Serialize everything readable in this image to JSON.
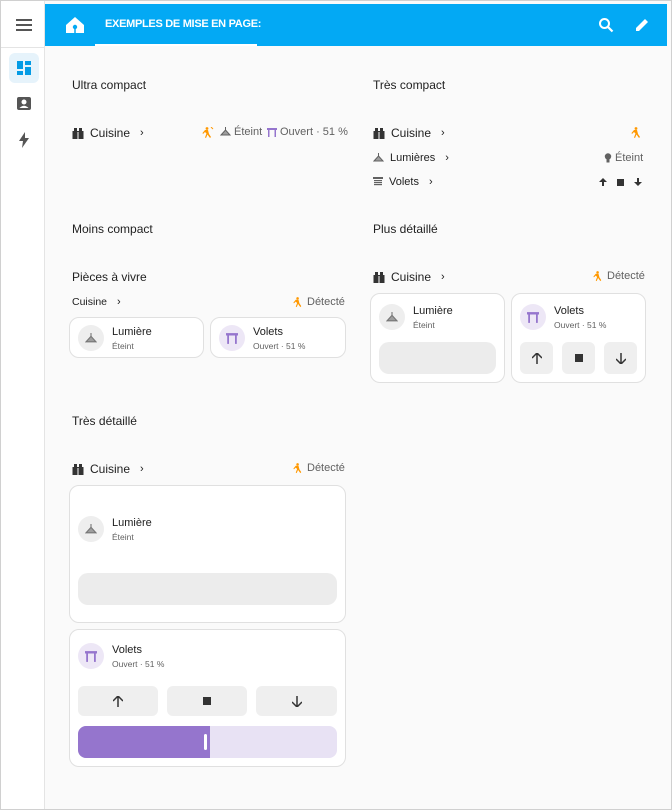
{
  "header": {
    "title": "EXEMPLES DE MISE EN PAGE:",
    "menu_icon": "menu-icon",
    "logo_icon": "home-assistant-logo-icon",
    "search_icon": "search-icon",
    "edit_icon": "pencil-icon"
  },
  "sidebar": {
    "items": [
      {
        "icon": "dashboard-icon",
        "active": true
      },
      {
        "icon": "account-box-icon",
        "active": false
      },
      {
        "icon": "lightning-icon",
        "active": false
      }
    ]
  },
  "colors": {
    "accent": "#03a9f4",
    "motion": "#ff9800",
    "cover": "#9575cd",
    "cover_light": "#e8e2f4"
  },
  "sections": {
    "ultra": {
      "title": "Ultra compact",
      "area": "Cuisine",
      "light_state": "Éteint",
      "cover_state": "Ouvert · 51 %"
    },
    "tres_compact": {
      "title": "Très compact",
      "area": "Cuisine",
      "lights_label": "Lumières",
      "light_state": "Éteint",
      "covers_label": "Volets"
    },
    "moins": {
      "title": "Moins compact",
      "group_title": "Pièces à vivre",
      "area": "Cuisine",
      "detected": "Détecté",
      "light_name": "Lumière",
      "light_state": "Éteint",
      "cover_name": "Volets",
      "cover_state": "Ouvert · 51 %"
    },
    "plus": {
      "title": "Plus détaillé",
      "area": "Cuisine",
      "detected": "Détecté",
      "light_name": "Lumière",
      "light_state": "Éteint",
      "cover_name": "Volets",
      "cover_state": "Ouvert · 51 %"
    },
    "tres_detaille": {
      "title": "Très détaillé",
      "area": "Cuisine",
      "detected": "Détecté",
      "light_name": "Lumière",
      "light_state": "Éteint",
      "cover_name": "Volets",
      "cover_state": "Ouvert · 51 %",
      "cover_position_percent": 51
    }
  }
}
